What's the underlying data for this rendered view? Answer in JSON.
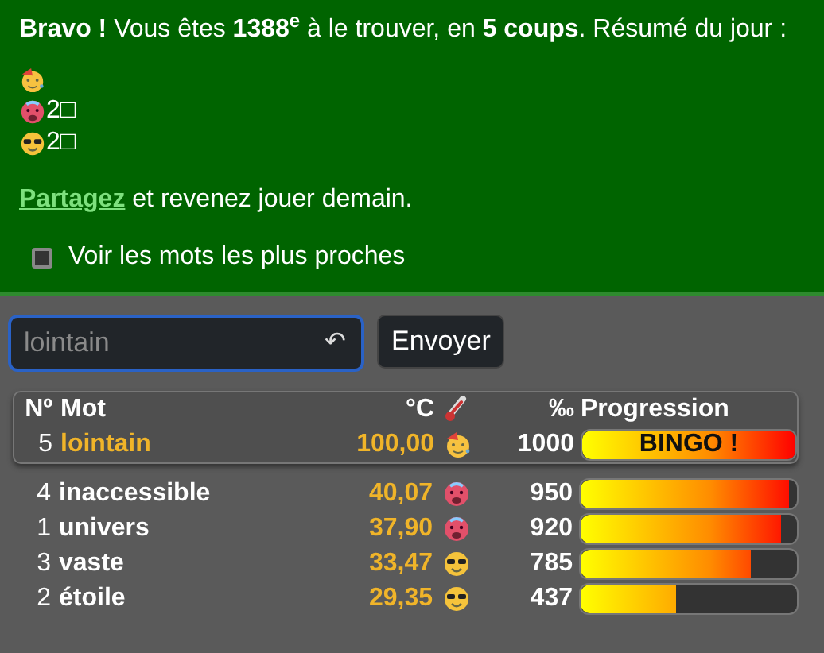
{
  "result": {
    "message": "**Bravo !** Vous êtes **1388$^{e}$** à le trouver, en **5 coups**. Résumé du jour :",
    "summary": [
      {
        "kind": "party"
      },
      {
        "kind": "hot",
        "text": "2□"
      },
      {
        "kind": "cool",
        "text": "2□"
      }
    ],
    "share_link": "Partagez",
    "share_text": " et revenez jouer demain.",
    "closest_option": {
      "label": "Voir les mots les plus proches",
      "checked": false
    }
  },
  "guess_form": {
    "placeholder": "lointain",
    "undo_glyph": "↶",
    "submit": "Envoyer"
  },
  "table": {
    "columns": [
      "Nº",
      "Mot",
      "°C",
      "‰",
      "Progression"
    ],
    "rows": [
      {
        "number": "5",
        "word": "lointain",
        "temperature": "100,00",
        "kind": "party",
        "score": "1000",
        "level": 1.0,
        "bar_label": "BINGO !",
        "latest": true
      },
      {
        "number": "4",
        "word": "inaccessible",
        "temperature": "40,07",
        "kind": "hot",
        "score": "950",
        "level": 0.96,
        "latest": false
      },
      {
        "number": "1",
        "word": "univers",
        "temperature": "37,90",
        "kind": "hot",
        "score": "920",
        "level": 0.93,
        "latest": false
      },
      {
        "number": "3",
        "word": "vaste",
        "temperature": "33,47",
        "kind": "cool",
        "score": "785",
        "level": 0.79,
        "latest": false
      },
      {
        "number": "2",
        "word": "étoile",
        "temperature": "29,35",
        "kind": "cool",
        "score": "437",
        "level": 0.44,
        "latest": false
      }
    ]
  }
}
